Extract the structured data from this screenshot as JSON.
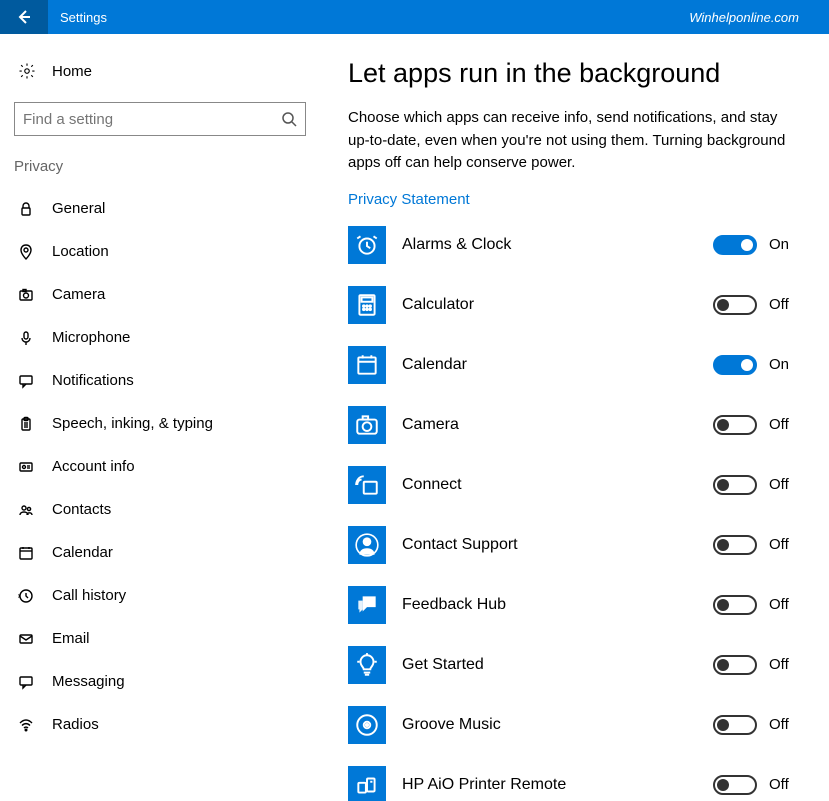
{
  "titlebar": {
    "title": "Settings",
    "brand": "Winhelponline.com"
  },
  "sidebar": {
    "home_label": "Home",
    "search_placeholder": "Find a setting",
    "section_header": "Privacy",
    "items": [
      {
        "icon": "lock",
        "label": "General"
      },
      {
        "icon": "location",
        "label": "Location"
      },
      {
        "icon": "camera",
        "label": "Camera"
      },
      {
        "icon": "mic",
        "label": "Microphone"
      },
      {
        "icon": "bubble",
        "label": "Notifications"
      },
      {
        "icon": "clip",
        "label": "Speech, inking, & typing"
      },
      {
        "icon": "badge",
        "label": "Account info"
      },
      {
        "icon": "people",
        "label": "Contacts"
      },
      {
        "icon": "calendar",
        "label": "Calendar"
      },
      {
        "icon": "history",
        "label": "Call history"
      },
      {
        "icon": "mail",
        "label": "Email"
      },
      {
        "icon": "bubble",
        "label": "Messaging"
      },
      {
        "icon": "wifi",
        "label": "Radios"
      }
    ]
  },
  "main": {
    "heading": "Let apps run in the background",
    "description": "Choose which apps can receive info, send notifications, and stay up-to-date, even when you're not using them. Turning background apps off can help conserve power.",
    "privacy_link": "Privacy Statement",
    "state_on": "On",
    "state_off": "Off",
    "apps": [
      {
        "icon": "clock",
        "name": "Alarms & Clock",
        "on": true
      },
      {
        "icon": "calc",
        "name": "Calculator",
        "on": false
      },
      {
        "icon": "calendar",
        "name": "Calendar",
        "on": true
      },
      {
        "icon": "camera",
        "name": "Camera",
        "on": false
      },
      {
        "icon": "connect",
        "name": "Connect",
        "on": false
      },
      {
        "icon": "support",
        "name": "Contact Support",
        "on": false
      },
      {
        "icon": "bubbleex",
        "name": "Feedback Hub",
        "on": false
      },
      {
        "icon": "bulb",
        "name": "Get Started",
        "on": false
      },
      {
        "icon": "disc",
        "name": "Groove Music",
        "on": false
      },
      {
        "icon": "printer",
        "name": "HP AiO Printer Remote",
        "on": false
      }
    ]
  }
}
